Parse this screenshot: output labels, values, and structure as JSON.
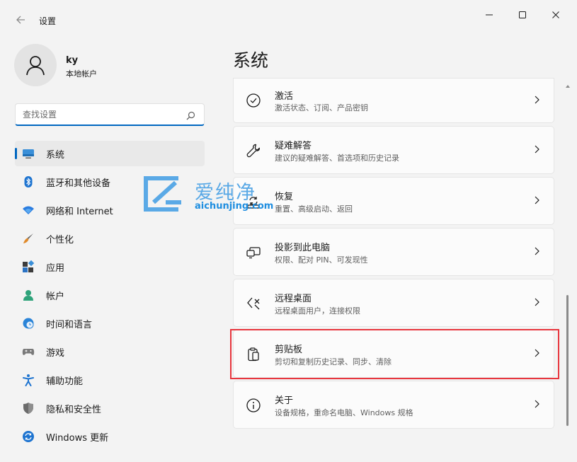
{
  "window": {
    "title": "设置"
  },
  "profile": {
    "name": "ky",
    "account_type": "本地帐户"
  },
  "search": {
    "placeholder": "查找设置"
  },
  "sidebar": {
    "items": [
      {
        "label": "系统",
        "icon": "system-icon",
        "active": true
      },
      {
        "label": "蓝牙和其他设备",
        "icon": "bluetooth-icon"
      },
      {
        "label": "网络和 Internet",
        "icon": "wifi-icon"
      },
      {
        "label": "个性化",
        "icon": "brush-icon"
      },
      {
        "label": "应用",
        "icon": "apps-icon"
      },
      {
        "label": "帐户",
        "icon": "person-icon"
      },
      {
        "label": "时间和语言",
        "icon": "clock-globe-icon"
      },
      {
        "label": "游戏",
        "icon": "gamepad-icon"
      },
      {
        "label": "辅助功能",
        "icon": "accessibility-icon"
      },
      {
        "label": "隐私和安全性",
        "icon": "shield-icon"
      },
      {
        "label": "Windows 更新",
        "icon": "update-icon"
      }
    ]
  },
  "main": {
    "title": "系统",
    "cards": [
      {
        "title": "激活",
        "subtitle": "激活状态、订阅、产品密钥",
        "icon": "check-circle-icon"
      },
      {
        "title": "疑难解答",
        "subtitle": "建议的疑难解答、首选项和历史记录",
        "icon": "wrench-icon"
      },
      {
        "title": "恢复",
        "subtitle": "重置、高级启动、返回",
        "icon": "recovery-icon"
      },
      {
        "title": "投影到此电脑",
        "subtitle": "权限、配对 PIN、可发现性",
        "icon": "projection-icon"
      },
      {
        "title": "远程桌面",
        "subtitle": "远程桌面用户，连接权限",
        "icon": "remote-desktop-icon"
      },
      {
        "title": "剪贴板",
        "subtitle": "剪切和复制历史记录、同步、清除",
        "icon": "clipboard-icon"
      },
      {
        "title": "关于",
        "subtitle": "设备规格，重命名电脑、Windows 规格",
        "icon": "info-icon"
      }
    ]
  },
  "watermark": {
    "text_cn": "爱纯净",
    "text_en": "aichunjing.com"
  },
  "colors": {
    "accent": "#0067c0",
    "highlight": "#e8363e",
    "background": "#f3f3f3"
  }
}
